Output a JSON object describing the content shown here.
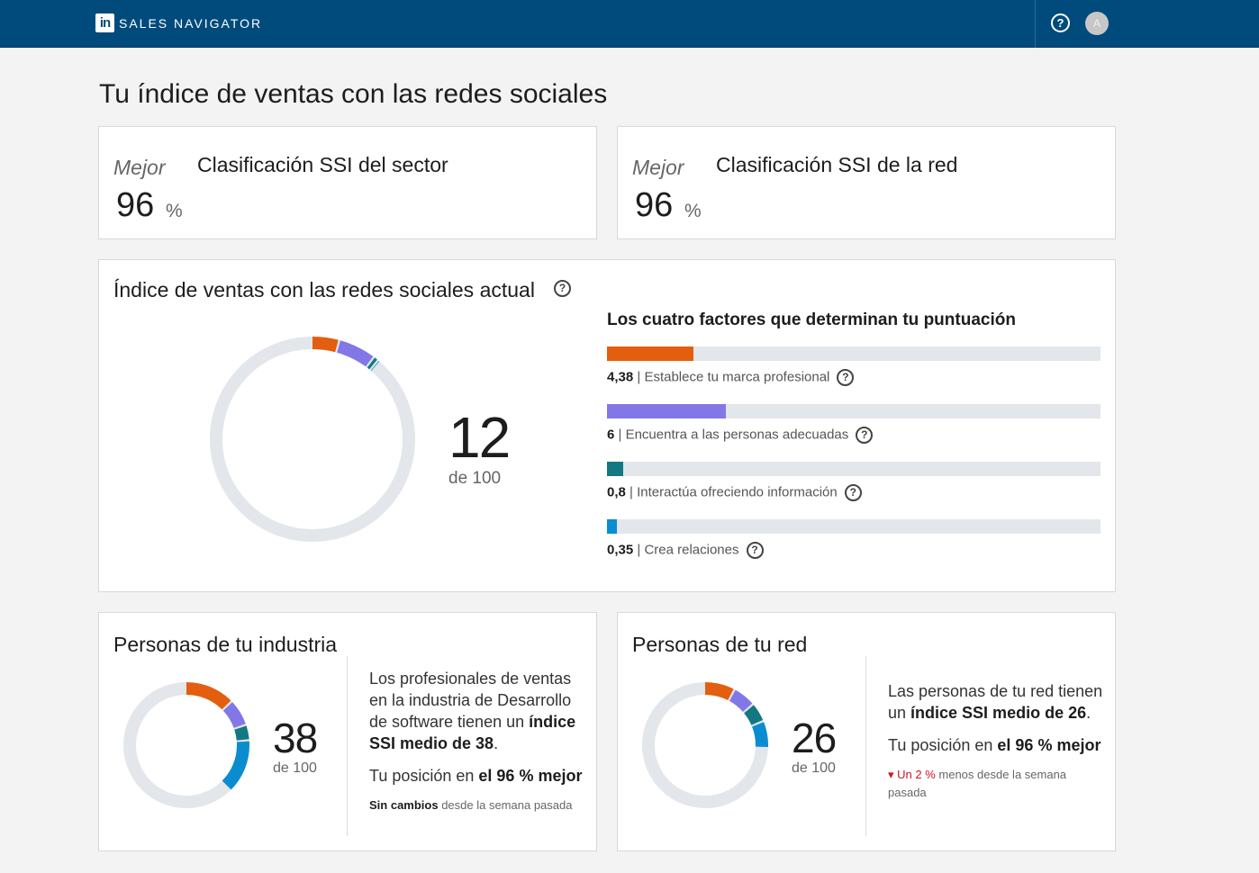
{
  "header": {
    "logo_text": "in",
    "brand": "SALES NAVIGATOR",
    "help_icon": "?",
    "avatar_initial": "A",
    "bar_color": "#004b7c"
  },
  "page": {
    "title": "Tu índice de ventas con las redes sociales"
  },
  "rank_cards": [
    {
      "prefix": "Mejor",
      "value": "96",
      "unit": "%",
      "title": "Clasificación SSI del sector"
    },
    {
      "prefix": "Mejor",
      "value": "96",
      "unit": "%",
      "title": "Clasificación SSI de la red"
    }
  ],
  "current": {
    "title": "Índice de ventas con las redes sociales actual",
    "score": "12",
    "score_sub": "de 100",
    "max": 100,
    "factors_title": "Los cuatro factores que determinan tu puntuación",
    "factors": [
      {
        "value_label": "4,38",
        "value": 4.38,
        "max": 25,
        "label": "| Establece tu marca profesional",
        "color": "#e35e0f"
      },
      {
        "value_label": "6",
        "value": 6,
        "max": 25,
        "label": "| Encuentra a las personas adecuadas",
        "color": "#8377e8"
      },
      {
        "value_label": "0,8",
        "value": 0.8,
        "max": 25,
        "label": "| Interactúa ofreciendo información",
        "color": "#137882"
      },
      {
        "value_label": "0,35",
        "value": 0.35,
        "max": 25,
        "label": "| Crea relaciones",
        "color": "#0a8cd1"
      }
    ]
  },
  "industry": {
    "title": "Personas de tu industria",
    "score": "38",
    "score_sub": "de 100",
    "segments": [
      13,
      7,
      4,
      14
    ],
    "text_a": "Los profesionales de ventas en la industria de Desarrollo de software tienen un ",
    "text_bold": "índice SSI medio de 38",
    "text_end": ".",
    "pos_prefix": "Tu posición en ",
    "pos_bold": "el 96 % mejor",
    "change_bold": "Sin cambios",
    "change_rest": " desde la semana pasada"
  },
  "network": {
    "title": "Personas de tu red",
    "score": "26",
    "score_sub": "de 100",
    "segments": [
      8,
      6,
      5,
      7
    ],
    "text_a": "Las personas de tu red tienen un ",
    "text_bold": "índice SSI medio de 26",
    "text_end": ".",
    "pos_prefix": "Tu posición en ",
    "pos_bold": "el 96 % mejor",
    "change_red": "▾ Un 2 %",
    "change_rest": " menos desde la semana pasada"
  },
  "colors": {
    "orange": "#e35e0f",
    "purple": "#8377e8",
    "teal": "#137882",
    "blue": "#0a8cd1",
    "track": "#e3e6ea"
  }
}
